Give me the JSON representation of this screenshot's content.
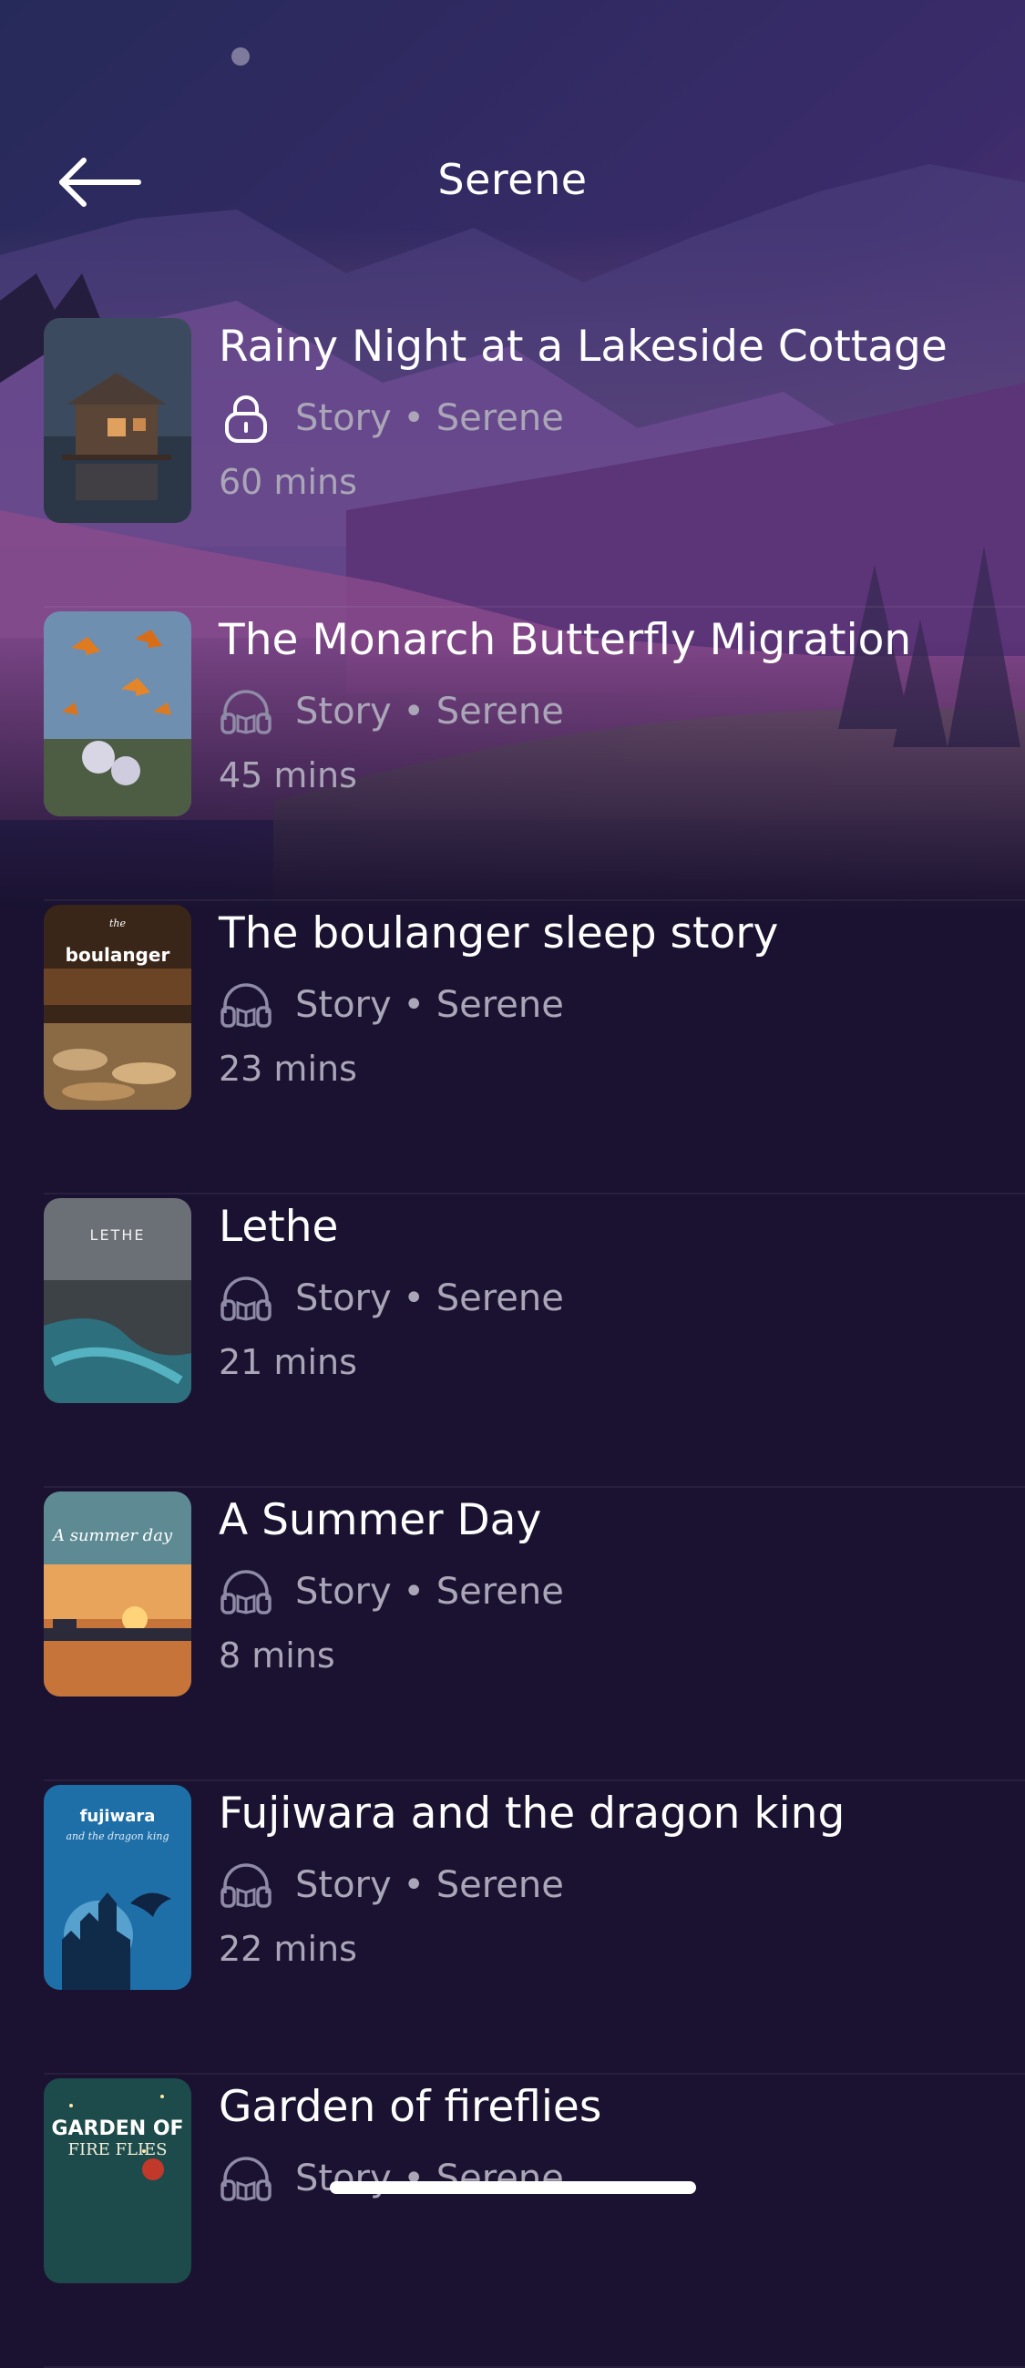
{
  "header": {
    "title": "Serene",
    "back_icon": "arrow-left-icon"
  },
  "items": [
    {
      "title": "Rainy Night at a Lakeside Cottage",
      "category": "Story • Serene",
      "duration": "60 mins",
      "icon": "lock-icon"
    },
    {
      "title": "The Monarch Butterfly Migration",
      "category": "Story • Serene",
      "duration": "45 mins",
      "icon": "headphones-icon"
    },
    {
      "title": "The boulanger sleep story",
      "category": "Story • Serene",
      "duration": "23 mins",
      "icon": "headphones-icon",
      "cover_text": "boulanger",
      "cover_small": "the"
    },
    {
      "title": "Lethe",
      "category": "Story • Serene",
      "duration": "21 mins",
      "icon": "headphones-icon",
      "cover_text": "LETHE"
    },
    {
      "title": "A Summer Day",
      "category": "Story • Serene",
      "duration": "8 mins",
      "icon": "headphones-icon",
      "cover_text": "A summer day"
    },
    {
      "title": "Fujiwara and the dragon king",
      "category": "Story • Serene",
      "duration": "22 mins",
      "icon": "headphones-icon",
      "cover_text": "fujiwara",
      "cover_small": "and the dragon king"
    },
    {
      "title": "Garden of fireflies",
      "category": "Story • Serene",
      "duration": "",
      "icon": "headphones-icon",
      "cover_text": "GARDEN OF",
      "cover_small": "FIRE FLIES"
    }
  ],
  "colors": {
    "background": "#1a1230",
    "muted_text": "#aaa6b8"
  }
}
